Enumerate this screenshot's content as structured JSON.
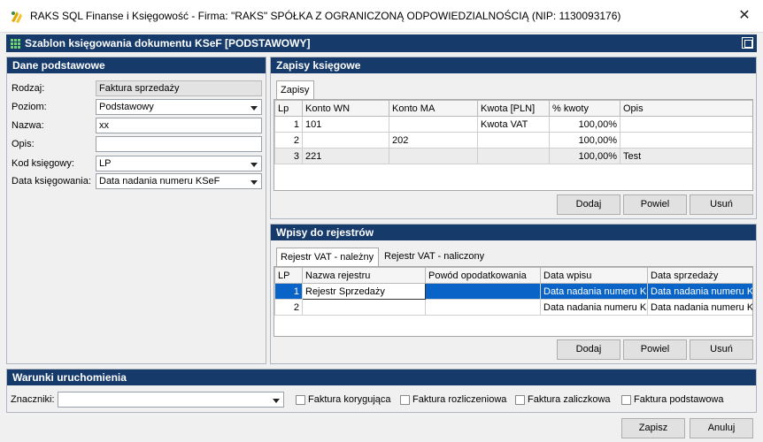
{
  "window": {
    "title": "RAKS SQL Finanse i Księgowość - Firma: \"RAKS\" SPÓŁKA Z OGRANICZONĄ ODPOWIEDZIALNOŚCIĄ (NIP: 1130093176)",
    "close": "✕"
  },
  "form": {
    "title": "Szablon księgowania dokumentu KSeF [PODSTAWOWY]"
  },
  "basic": {
    "header": "Dane podstawowe",
    "rodzaj_label": "Rodzaj:",
    "rodzaj_value": "Faktura sprzedaży",
    "poziom_label": "Poziom:",
    "poziom_value": "Podstawowy",
    "nazwa_label": "Nazwa:",
    "nazwa_value": "xx",
    "opis_label": "Opis:",
    "opis_value": "",
    "kod_label": "Kod księgowy:",
    "kod_value": "LP",
    "data_label": "Data księgowania:",
    "data_value": "Data nadania numeru KSeF"
  },
  "entries": {
    "header": "Zapisy księgowe",
    "tab": "Zapisy",
    "columns": [
      "Lp",
      "Konto WN",
      "Konto MA",
      "Kwota [PLN]",
      "% kwoty",
      "Opis"
    ],
    "rows": [
      {
        "lp": "1",
        "wn": "101",
        "ma": "",
        "kwota": "Kwota VAT",
        "pct": "100,00%",
        "opis": ""
      },
      {
        "lp": "2",
        "wn": "",
        "ma": "202",
        "kwota": "",
        "pct": "100,00%",
        "opis": ""
      },
      {
        "lp": "3",
        "wn": "221",
        "ma": "",
        "kwota": "",
        "pct": "100,00%",
        "opis": "Test"
      }
    ],
    "btn_add": "Dodaj",
    "btn_repeat": "Powiel",
    "btn_delete": "Usuń"
  },
  "registers": {
    "header": "Wpisy do rejestrów",
    "tab_active": "Rejestr VAT - należny",
    "tab_other": "Rejestr VAT - naliczony",
    "columns": [
      "LP",
      "Nazwa rejestru",
      "Powód opodatkowania",
      "Data wpisu",
      "Data sprzedaży"
    ],
    "rows": [
      {
        "lp": "1",
        "name": "Rejestr Sprzedaży",
        "reason": "",
        "entry_date": "Data nadania numeru KSeF",
        "sale_date": "Data nadania numeru KSeF"
      },
      {
        "lp": "2",
        "name": "",
        "reason": "",
        "entry_date": "Data nadania numeru KSeF",
        "sale_date": "Data nadania numeru KSeF"
      }
    ],
    "btn_add": "Dodaj",
    "btn_repeat": "Powiel",
    "btn_delete": "Usuń"
  },
  "conditions": {
    "header": "Warunki uruchomienia",
    "tags_label": "Znaczniki:",
    "tags_value": "",
    "chk_correction": "Faktura korygująca",
    "chk_settlement": "Faktura rozliczeniowa",
    "chk_advance": "Faktura zaliczkowa",
    "chk_basic": "Faktura podstawowa"
  },
  "footer": {
    "save": "Zapisz",
    "cancel": "Anuluj"
  },
  "colors": {
    "header_bg": "#163a6a",
    "selection": "#0a64c8"
  }
}
